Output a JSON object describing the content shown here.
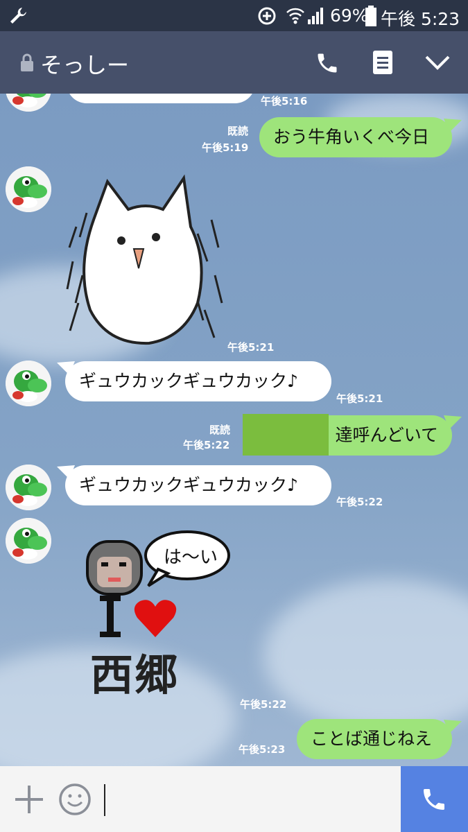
{
  "status_bar": {
    "battery": "69%",
    "time": "午後 5:23"
  },
  "header": {
    "title": "そっしー"
  },
  "messages": [
    {
      "time": "午後5:16"
    },
    {
      "read": "既読",
      "time": "午後5:19",
      "text": "おう牛角いくべ今日"
    },
    {
      "time": "午後5:21"
    },
    {
      "time": "午後5:21",
      "text": "ギュウカックギュウカック♪"
    },
    {
      "read": "既読",
      "time": "午後5:22",
      "text": "達呼んどいて"
    },
    {
      "time": "午後5:22",
      "text": "ギュウカックギュウカック♪"
    },
    {
      "time": "午後5:22",
      "sticker_speech": "は〜い",
      "sticker_text": "西郷"
    },
    {
      "time": "午後5:23",
      "text": "ことば通じねえ"
    }
  ],
  "colors": {
    "outgoing_bubble": "#9ee47b",
    "incoming_bubble": "#ffffff",
    "header": "#46506a",
    "call_button": "#5582e2"
  }
}
